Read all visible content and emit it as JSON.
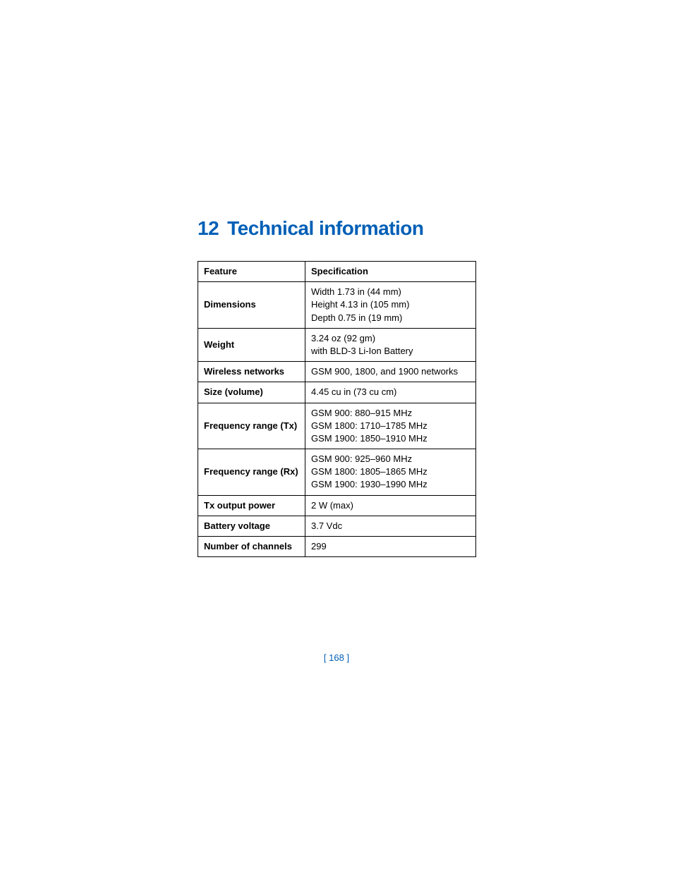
{
  "chapter": {
    "number": "12",
    "title": "Technical information"
  },
  "table": {
    "header": {
      "feature": "Feature",
      "spec": "Specification"
    },
    "rows": [
      {
        "feature": "Dimensions",
        "spec": "Width 1.73 in (44 mm)\nHeight 4.13 in (105 mm)\nDepth 0.75 in (19 mm)"
      },
      {
        "feature": "Weight",
        "spec": "3.24 oz (92 gm)\nwith BLD-3 Li-Ion Battery"
      },
      {
        "feature": "Wireless networks",
        "spec": "GSM 900, 1800, and 1900 networks"
      },
      {
        "feature": "Size (volume)",
        "spec": "4.45 cu in (73 cu cm)"
      },
      {
        "feature": "Frequency range (Tx)",
        "spec": "GSM 900: 880–915 MHz\nGSM 1800: 1710–1785 MHz\nGSM 1900: 1850–1910 MHz"
      },
      {
        "feature": "Frequency range (Rx)",
        "spec": "GSM 900: 925–960 MHz\nGSM 1800: 1805–1865 MHz\nGSM 1900: 1930–1990 MHz"
      },
      {
        "feature": "Tx output power",
        "spec": "2 W (max)"
      },
      {
        "feature": "Battery voltage",
        "spec": "3.7 Vdc"
      },
      {
        "feature": "Number of channels",
        "spec": "299"
      }
    ]
  },
  "page_number": "[ 168 ]"
}
